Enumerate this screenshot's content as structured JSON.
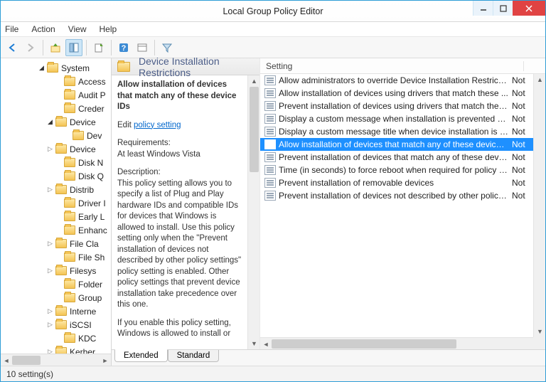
{
  "title": "Local Group Policy Editor",
  "menu": {
    "file": "File",
    "action": "Action",
    "view": "View",
    "help": "Help"
  },
  "tree": [
    {
      "indent": 52,
      "expander": "open",
      "label": "System"
    },
    {
      "indent": 76,
      "expander": "",
      "label": "Access"
    },
    {
      "indent": 76,
      "expander": "",
      "label": "Audit P"
    },
    {
      "indent": 76,
      "expander": "",
      "label": "Creder"
    },
    {
      "indent": 64,
      "expander": "open",
      "label": "Device"
    },
    {
      "indent": 88,
      "expander": "",
      "label": "Dev"
    },
    {
      "indent": 64,
      "expander": "closed",
      "label": "Device"
    },
    {
      "indent": 76,
      "expander": "",
      "label": "Disk N"
    },
    {
      "indent": 76,
      "expander": "",
      "label": "Disk Q"
    },
    {
      "indent": 64,
      "expander": "closed",
      "label": "Distrib"
    },
    {
      "indent": 76,
      "expander": "",
      "label": "Driver I"
    },
    {
      "indent": 76,
      "expander": "",
      "label": "Early L"
    },
    {
      "indent": 76,
      "expander": "",
      "label": "Enhanc"
    },
    {
      "indent": 64,
      "expander": "closed",
      "label": "File Cla"
    },
    {
      "indent": 76,
      "expander": "",
      "label": "File Sh"
    },
    {
      "indent": 64,
      "expander": "closed",
      "label": "Filesys"
    },
    {
      "indent": 76,
      "expander": "",
      "label": "Folder"
    },
    {
      "indent": 76,
      "expander": "",
      "label": "Group"
    },
    {
      "indent": 64,
      "expander": "closed",
      "label": "Interne"
    },
    {
      "indent": 64,
      "expander": "closed",
      "label": "iSCSI"
    },
    {
      "indent": 76,
      "expander": "",
      "label": "KDC"
    },
    {
      "indent": 64,
      "expander": "closed",
      "label": "Kerber"
    }
  ],
  "pageTitle": "Device Installation Restrictions",
  "details": {
    "selectedPolicy": "Allow installation of devices that match any of these device IDs",
    "editPrefix": "Edit ",
    "editLink": "policy setting",
    "reqLabel": "Requirements:",
    "reqValue": "At least Windows Vista",
    "descLabel": "Description:",
    "descText": "This policy setting allows you to specify a list of Plug and Play hardware IDs and compatible IDs for devices that Windows is allowed to install. Use this policy setting only when the \"Prevent installation of devices not described by other policy settings\" policy setting is enabled. Other policy settings that prevent device installation take precedence over this one.",
    "descText2": "If you enable this policy setting, Windows is allowed to install or"
  },
  "list": {
    "headerSetting": "Setting",
    "headerState": "",
    "items": [
      {
        "label": "Allow administrators to override Device Installation Restricti...",
        "state": "Not",
        "selected": false
      },
      {
        "label": "Allow installation of devices using drivers that match these ...",
        "state": "Not",
        "selected": false
      },
      {
        "label": "Prevent installation of devices using drivers that match thes...",
        "state": "Not",
        "selected": false
      },
      {
        "label": "Display a custom message when installation is prevented by...",
        "state": "Not",
        "selected": false
      },
      {
        "label": "Display a custom message title when device installation is pr...",
        "state": "Not",
        "selected": false
      },
      {
        "label": "Allow installation of devices that match any of these device ...",
        "state": "Not",
        "selected": true
      },
      {
        "label": "Prevent installation of devices that match any of these devic...",
        "state": "Not",
        "selected": false
      },
      {
        "label": "Time (in seconds) to force reboot when required for policy c...",
        "state": "Not",
        "selected": false
      },
      {
        "label": "Prevent installation of removable devices",
        "state": "Not",
        "selected": false
      },
      {
        "label": "Prevent installation of devices not described by other policy ...",
        "state": "Not",
        "selected": false
      }
    ]
  },
  "tabs": {
    "extended": "Extended",
    "standard": "Standard"
  },
  "status": "10 setting(s)"
}
